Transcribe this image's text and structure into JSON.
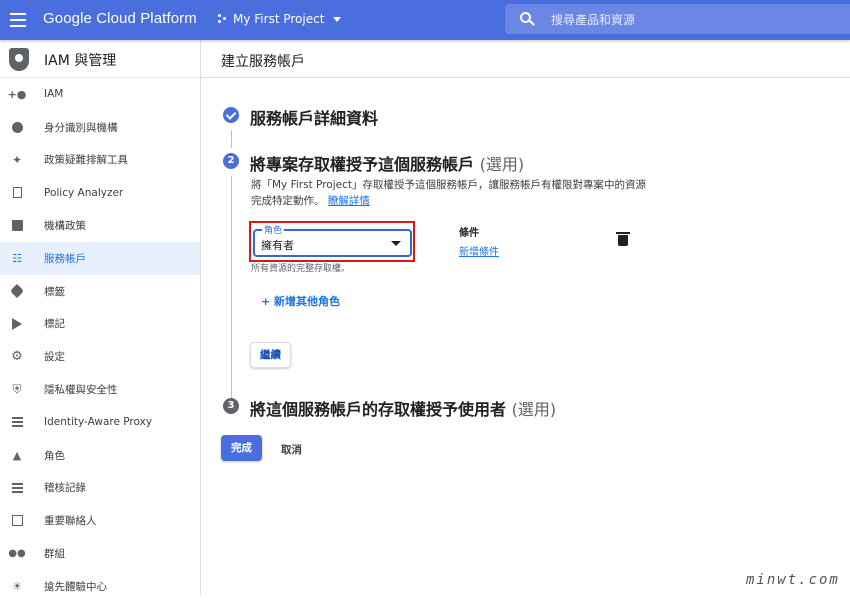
{
  "topbar": {
    "brand": "Google Cloud Platform",
    "project": "My First Project",
    "search_placeholder": "搜尋產品和資源"
  },
  "sidebar": {
    "title": "IAM 與管理",
    "items": [
      {
        "label": "IAM",
        "icon": "add-person-icon"
      },
      {
        "label": "身分識別與機構",
        "icon": "account-circle-icon"
      },
      {
        "label": "政策疑難排解工具",
        "icon": "wrench-icon"
      },
      {
        "label": "Policy Analyzer",
        "icon": "document-search-icon"
      },
      {
        "label": "機構政策",
        "icon": "list-box-icon"
      },
      {
        "label": "服務帳戶",
        "icon": "service-account-icon",
        "active": true
      },
      {
        "label": "標籤",
        "icon": "tag-icon"
      },
      {
        "label": "標記",
        "icon": "label-arrow-icon"
      },
      {
        "label": "設定",
        "icon": "gear-icon"
      },
      {
        "label": "隱私權與安全性",
        "icon": "shield-icon"
      },
      {
        "label": "Identity-Aware Proxy",
        "icon": "proxy-icon"
      },
      {
        "label": "角色",
        "icon": "hat-icon"
      },
      {
        "label": "稽核記錄",
        "icon": "lines-icon"
      },
      {
        "label": "重要聯絡人",
        "icon": "contact-card-icon"
      },
      {
        "label": "群組",
        "icon": "group-icon"
      },
      {
        "label": "搶先體驗中心",
        "icon": "lightbulb-icon"
      }
    ]
  },
  "main": {
    "page_title": "建立服務帳戶",
    "step1": {
      "title": "服務帳戶詳細資料"
    },
    "step2": {
      "number": "2",
      "title": "將專案存取權授予這個服務帳戶",
      "optional": "(選用)",
      "description": "將「My First Project」存取權授予這個服務帳戶，讓服務帳戶有權限對專案中的資源完成特定動作。",
      "learn_more": "瞭解詳情",
      "role_label": "角色",
      "role_value": "擁有者",
      "role_help": "所有資源的完整存取權。",
      "condition_label": "條件",
      "add_condition": "新增條件",
      "add_role": "+ 新增其他角色",
      "continue": "繼續"
    },
    "step3": {
      "number": "3",
      "title": "將這個服務帳戶的存取權授予使用者",
      "optional": "(選用)"
    },
    "done": "完成",
    "cancel": "取消"
  },
  "watermark": "minwt.com"
}
